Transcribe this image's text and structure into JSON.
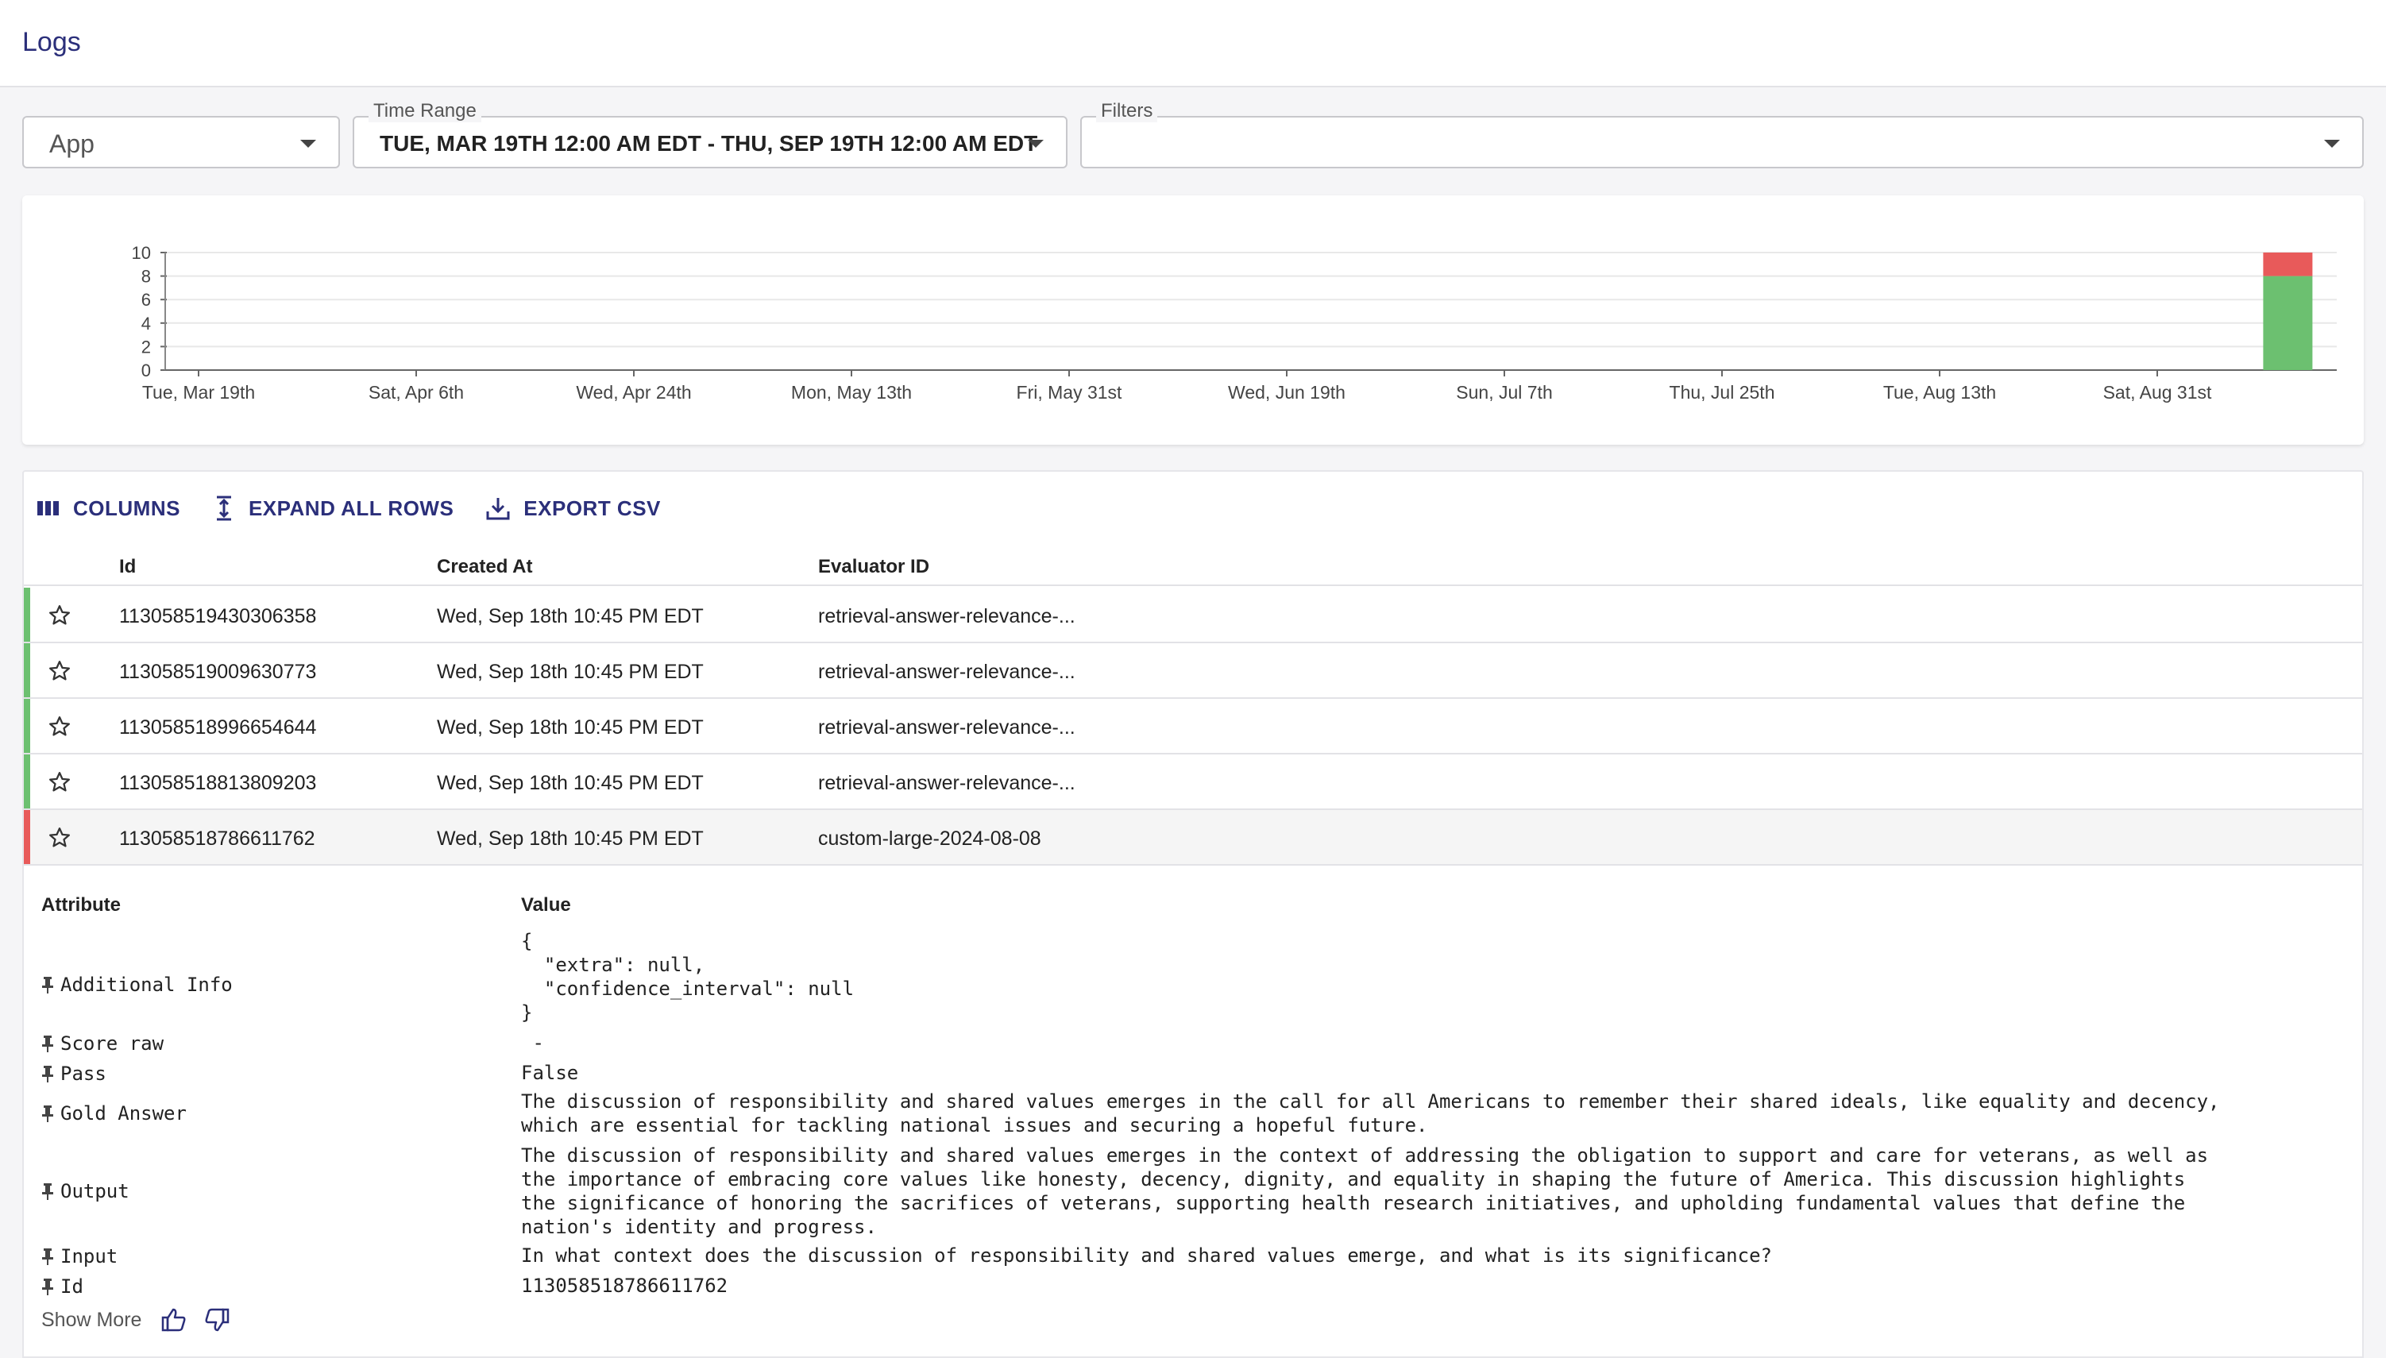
{
  "header": {
    "title": "Logs"
  },
  "app_select": {
    "value": "App"
  },
  "time_range": {
    "label": "Time Range",
    "value": "TUE, MAR 19TH 12:00 AM EDT - THU, SEP 19TH 12:00 AM EDT"
  },
  "filters": {
    "label": "Filters",
    "value": ""
  },
  "chart_data": {
    "type": "bar",
    "stacked": true,
    "ylim": [
      0,
      10
    ],
    "yticks": [
      "0",
      "2",
      "4",
      "6",
      "8",
      "10"
    ],
    "xticks": [
      "Tue, Mar 19th",
      "Sat, Apr 6th",
      "Wed, Apr 24th",
      "Mon, May 13th",
      "Fri, May 31st",
      "Wed, Jun 19th",
      "Sun, Jul 7th",
      "Thu, Jul 25th",
      "Tue, Aug 13th",
      "Sat, Aug 31st"
    ],
    "grid": true,
    "series": [
      {
        "color": "#6cc070",
        "bars": [
          {
            "x_index": 9.6,
            "value": 8
          }
        ]
      },
      {
        "color": "#e85a5a",
        "bars": [
          {
            "x_index": 9.6,
            "value": 2
          }
        ]
      }
    ]
  },
  "toolbar": {
    "columns": "COLUMNS",
    "expand": "EXPAND ALL ROWS",
    "export": "EXPORT CSV"
  },
  "table": {
    "headers": {
      "id": "Id",
      "created": "Created At",
      "evaluator": "Evaluator ID"
    },
    "rows": [
      {
        "id": "113058519430306358",
        "created": "Wed, Sep 18th 10:45 PM EDT",
        "evaluator": "retrieval-answer-relevance-...",
        "status_color": "#6cc070"
      },
      {
        "id": "113058519009630773",
        "created": "Wed, Sep 18th 10:45 PM EDT",
        "evaluator": "retrieval-answer-relevance-...",
        "status_color": "#6cc070"
      },
      {
        "id": "113058518996654644",
        "created": "Wed, Sep 18th 10:45 PM EDT",
        "evaluator": "retrieval-answer-relevance-...",
        "status_color": "#6cc070"
      },
      {
        "id": "113058518813809203",
        "created": "Wed, Sep 18th 10:45 PM EDT",
        "evaluator": "retrieval-answer-relevance-...",
        "status_color": "#6cc070"
      },
      {
        "id": "113058518786611762",
        "created": "Wed, Sep 18th 10:45 PM EDT",
        "evaluator": "custom-large-2024-08-08",
        "status_color": "#e85a5a"
      }
    ]
  },
  "detail": {
    "attribute_header": "Attribute",
    "value_header": "Value",
    "items": [
      {
        "name": "Additional Info",
        "value": "{\n  \"extra\": null,\n  \"confidence_interval\": null\n}"
      },
      {
        "name": "Score raw",
        "value": " -"
      },
      {
        "name": "Pass",
        "value": "False"
      },
      {
        "name": "Gold Answer",
        "value": "The discussion of responsibility and shared values emerges in the call for all Americans to remember their shared ideals, like equality and decency,\nwhich are essential for tackling national issues and securing a hopeful future."
      },
      {
        "name": "Output",
        "value": "The discussion of responsibility and shared values emerges in the context of addressing the obligation to support and care for veterans, as well as\nthe importance of embracing core values like honesty, decency, dignity, and equality in shaping the future of America. This discussion highlights\nthe significance of honoring the sacrifices of veterans, supporting health research initiatives, and upholding fundamental values that define the\nnation's identity and progress."
      },
      {
        "name": "Input",
        "value": "In what context does the discussion of responsibility and shared values emerge, and what is its significance?"
      },
      {
        "name": "Id",
        "value": "113058518786611762"
      }
    ],
    "show_more": "Show More"
  },
  "icons": [
    "columns-icon",
    "expand-icon",
    "download-icon",
    "star-icon",
    "pin-icon",
    "thumbs-up-icon",
    "thumbs-down-icon",
    "chevron-down-icon"
  ]
}
